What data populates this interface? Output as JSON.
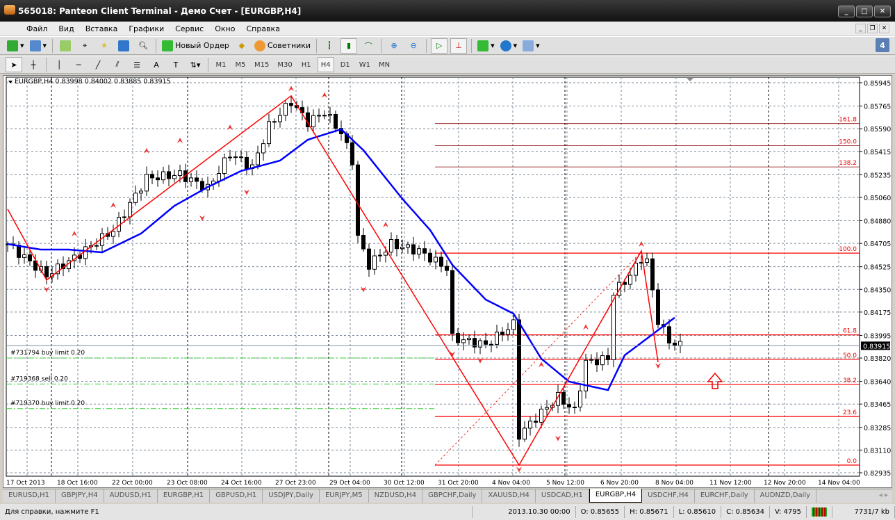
{
  "window": {
    "title": "565018: Panteon Client Terminal - Демо Счет - [EURGBP,H4]"
  },
  "menu": [
    "Файл",
    "Вид",
    "Вставка",
    "Графики",
    "Сервис",
    "Окно",
    "Справка"
  ],
  "toolbar": {
    "new_order": "Новый Ордер",
    "experts": "Советники",
    "notifications": "4"
  },
  "timeframes": [
    "M1",
    "M5",
    "M15",
    "M30",
    "H1",
    "H4",
    "D1",
    "W1",
    "MN"
  ],
  "active_timeframe": "H4",
  "chart": {
    "header": "EURGBP,H4  0.83998 0.84002 0.83885 0.83915",
    "current_price": "0.83915",
    "price_ticks": [
      "0.85945",
      "0.85765",
      "0.85590",
      "0.85415",
      "0.85235",
      "0.85060",
      "0.84880",
      "0.84705",
      "0.84525",
      "0.84350",
      "0.84175",
      "0.83995",
      "0.83820",
      "0.83640",
      "0.83465",
      "0.83285",
      "0.83110",
      "0.82935"
    ],
    "time_ticks": [
      "17 Oct 2013",
      "18 Oct 16:00",
      "22 Oct 00:00",
      "23 Oct 08:00",
      "24 Oct 16:00",
      "27 Oct 23:00",
      "29 Oct 04:00",
      "30 Oct 12:00",
      "31 Oct 20:00",
      "4 Nov 04:00",
      "5 Nov 12:00",
      "6 Nov 20:00",
      "8 Nov 04:00",
      "11 Nov 12:00",
      "12 Nov 20:00",
      "14 Nov 04:00"
    ],
    "orders": [
      {
        "label": "#731794 buy limit 0.20",
        "price": 0.8382
      },
      {
        "label": "#719368 sell 0.20",
        "price": 0.8362
      },
      {
        "label": "#719370 buy limit 0.20",
        "price": 0.8343
      }
    ],
    "fib_levels": [
      {
        "label": "161.8",
        "price": 0.8563
      },
      {
        "label": "150.0",
        "price": 0.8546
      },
      {
        "label": "138.2",
        "price": 0.85295
      },
      {
        "label": "100.0",
        "price": 0.8463
      },
      {
        "label": "61.8",
        "price": 0.83999
      },
      {
        "label": "50.0",
        "price": 0.8381
      },
      {
        "label": "38.2",
        "price": 0.83616
      },
      {
        "label": "23.6",
        "price": 0.83369
      },
      {
        "label": "0.0",
        "price": 0.82994
      }
    ],
    "price_keypoints": [
      [
        0,
        0.847
      ],
      [
        7,
        0.84459
      ],
      [
        12,
        0.84593
      ],
      [
        19,
        0.84808
      ],
      [
        25,
        0.8521
      ],
      [
        31,
        0.85237
      ],
      [
        36,
        0.85129
      ],
      [
        40,
        0.85398
      ],
      [
        44,
        0.8529
      ],
      [
        47,
        0.85612
      ],
      [
        51,
        0.858
      ],
      [
        54,
        0.85639
      ],
      [
        57,
        0.8572
      ],
      [
        60,
        0.85559
      ],
      [
        62,
        0.85344
      ],
      [
        63,
        0.84754
      ],
      [
        65,
        0.84539
      ],
      [
        69,
        0.847
      ],
      [
        74,
        0.84646
      ],
      [
        79,
        0.84513
      ],
      [
        80,
        0.83976
      ],
      [
        86,
        0.83922
      ],
      [
        91,
        0.84083
      ],
      [
        92,
        0.83225
      ],
      [
        95,
        0.83359
      ],
      [
        99,
        0.8352
      ],
      [
        102,
        0.83412
      ],
      [
        104,
        0.83788
      ],
      [
        108,
        0.83815
      ],
      [
        109,
        0.84325
      ],
      [
        112,
        0.84459
      ],
      [
        114,
        0.84593
      ],
      [
        115,
        0.84566
      ],
      [
        117,
        0.8411
      ],
      [
        119,
        0.83949
      ],
      [
        121,
        0.83915
      ]
    ],
    "ma_keypoints": [
      [
        0,
        0.847
      ],
      [
        6,
        0.84657
      ],
      [
        11,
        0.84657
      ],
      [
        17,
        0.84636
      ],
      [
        24,
        0.84781
      ],
      [
        30,
        0.84995
      ],
      [
        36,
        0.8514
      ],
      [
        42,
        0.85264
      ],
      [
        49,
        0.85344
      ],
      [
        54,
        0.85505
      ],
      [
        60,
        0.85586
      ],
      [
        64,
        0.85424
      ],
      [
        71,
        0.85049
      ],
      [
        76,
        0.84808
      ],
      [
        80,
        0.84539
      ],
      [
        86,
        0.84271
      ],
      [
        91,
        0.84163
      ],
      [
        96,
        0.83815
      ],
      [
        101,
        0.83638
      ],
      [
        108,
        0.83573
      ],
      [
        111,
        0.83842
      ],
      [
        116,
        0.84003
      ],
      [
        120,
        0.84132
      ]
    ],
    "zigzag": [
      [
        0,
        0.84969
      ],
      [
        7,
        0.84422
      ],
      [
        51,
        0.85844
      ],
      [
        92,
        0.82994
      ],
      [
        114,
        0.84647
      ],
      [
        117,
        0.83788
      ]
    ],
    "colors": {
      "ma": "#0000ff",
      "zigzag": "#ff0000",
      "orders": "#33cc33",
      "fib": "#ff0000"
    }
  },
  "tabs": [
    "EURUSD,H1",
    "GBPJPY,H4",
    "AUDUSD,H1",
    "EURGBP,H1",
    "GBPUSD,H1",
    "USDJPY,Daily",
    "EURJPY,M5",
    "NZDUSD,H4",
    "GBPCHF,Daily",
    "XAUUSD,H4",
    "USDCAD,H1",
    "EURGBP,H4",
    "USDCHF,H4",
    "EURCHF,Daily",
    "AUDNZD,Daily"
  ],
  "active_tab": "EURGBP,H4",
  "status": {
    "help": "Для справки, нажмите F1",
    "datetime": "2013.10.30 00:00",
    "open": "O: 0.85655",
    "high": "H: 0.85671",
    "low": "L: 0.85610",
    "close": "C: 0.85634",
    "volume": "V: 4795",
    "traffic": "7731/7 kb"
  }
}
